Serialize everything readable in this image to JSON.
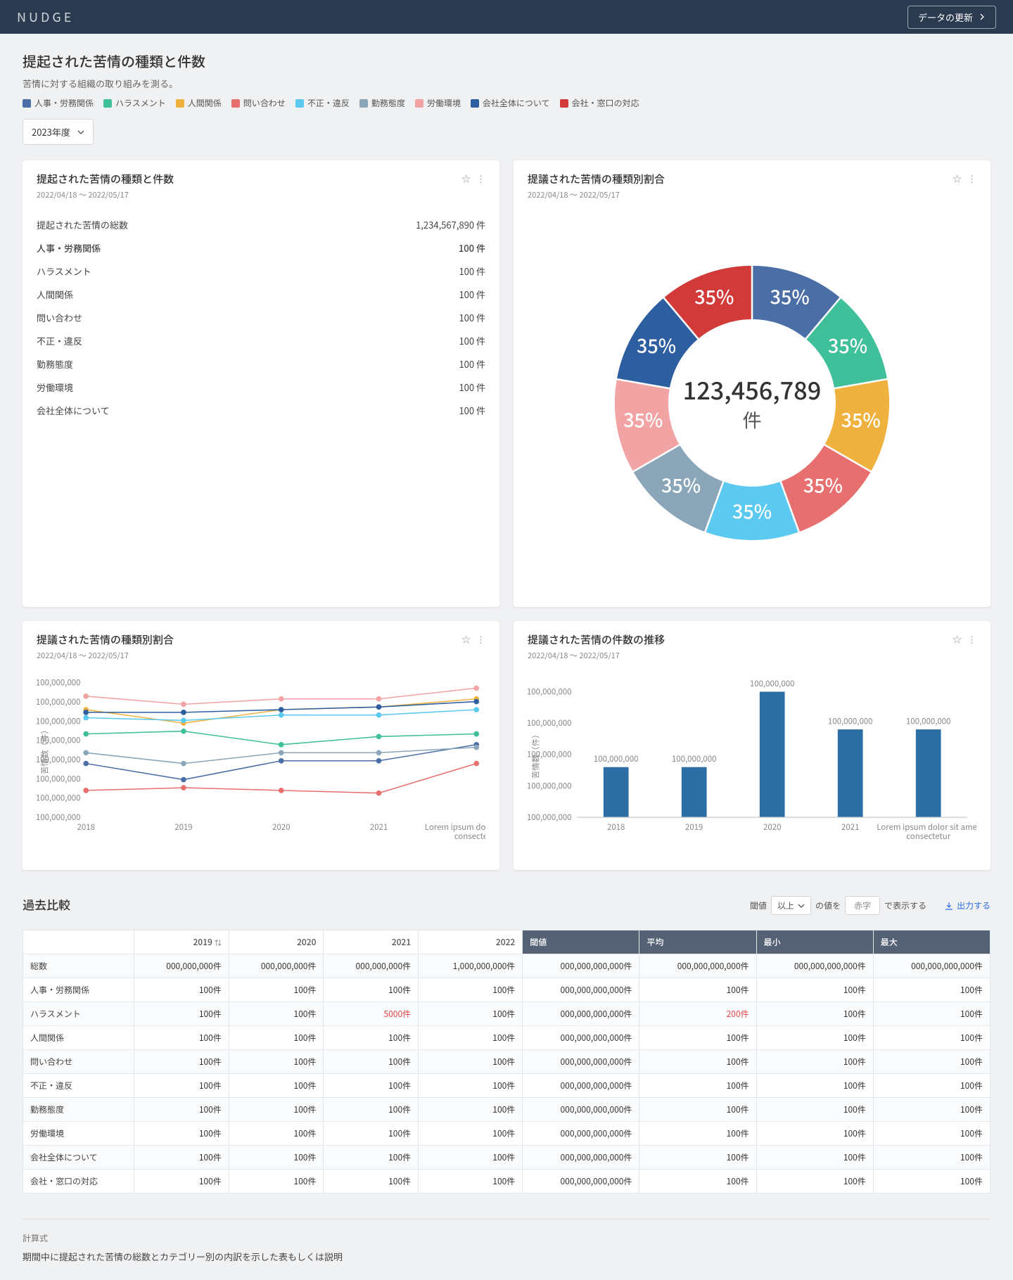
{
  "header": {
    "logo": "NUDGE",
    "update_btn": "データの更新"
  },
  "page": {
    "title": "提起された苦情の種類と件数",
    "subtitle": "苦情に対する組織の取り組みを測る。",
    "year_select": "2023年度"
  },
  "legend": [
    {
      "label": "人事・労務関係",
      "color": "#4a6ea5"
    },
    {
      "label": "ハラスメント",
      "color": "#3fbf9a"
    },
    {
      "label": "人間関係",
      "color": "#f0b23e"
    },
    {
      "label": "問い合わせ",
      "color": "#e76f6f"
    },
    {
      "label": "不正・違反",
      "color": "#5ccaf0"
    },
    {
      "label": "勤務態度",
      "color": "#8aa6b8"
    },
    {
      "label": "労働環境",
      "color": "#f2a3a3"
    },
    {
      "label": "会社全体について",
      "color": "#2d5ea0"
    },
    {
      "label": "会社・窓口の対応",
      "color": "#d23a3a"
    }
  ],
  "cards": {
    "summary": {
      "title": "提起された苦情の種類と件数",
      "date": "2022/04/18 〜 2022/05/17",
      "total_label": "提起された苦情の総数",
      "total_value": "1,234,567,890 件",
      "rows": [
        {
          "label": "人事・労務関係",
          "value": "100 件"
        },
        {
          "label": "ハラスメント",
          "value": "100 件"
        },
        {
          "label": "人間関係",
          "value": "100 件"
        },
        {
          "label": "問い合わせ",
          "value": "100 件"
        },
        {
          "label": "不正・違反",
          "value": "100 件"
        },
        {
          "label": "勤務態度",
          "value": "100 件"
        },
        {
          "label": "労働環境",
          "value": "100 件"
        },
        {
          "label": "会社全体について",
          "value": "100 件"
        }
      ]
    },
    "donut": {
      "title": "提議された苦情の種類別割合",
      "date": "2022/04/18 〜 2022/05/17",
      "center_value": "123,456,789",
      "center_unit": "件"
    },
    "line": {
      "title": "提議された苦情の種類別割合",
      "date": "2022/04/18 〜 2022/05/17",
      "ylabel": "苦情数（件）"
    },
    "bar": {
      "title": "提議された苦情の件数の推移",
      "date": "2022/04/18 〜 2022/05/17",
      "ylabel": "苦情数（件）"
    }
  },
  "compare": {
    "title": "過去比較",
    "threshold_label": "閾値",
    "cond_select": "以上",
    "value_label": "の値を",
    "redtext_label": "赤字",
    "display_label": "で表示する",
    "export": "出力する",
    "headers": {
      "y2019": "2019",
      "y2020": "2020",
      "y2021": "2021",
      "y2022": "2022",
      "threshold": "閾値",
      "avg": "平均",
      "min": "最小",
      "max": "最大"
    },
    "rows": [
      {
        "label": "総数",
        "y2019": "000,000,000件",
        "y2020": "000,000,000件",
        "y2021": "000,000,000件",
        "y2022": "1,000,000,000件",
        "threshold": "000,000,000,000件",
        "avg": "000,000,000,000件",
        "min": "000,000,000,000件",
        "max": "000,000,000,000件",
        "red": {}
      },
      {
        "label": "人事・労務関係",
        "y2019": "100件",
        "y2020": "100件",
        "y2021": "100件",
        "y2022": "100件",
        "threshold": "000,000,000,000件",
        "avg": "100件",
        "min": "100件",
        "max": "100件",
        "red": {}
      },
      {
        "label": "ハラスメント",
        "y2019": "100件",
        "y2020": "100件",
        "y2021": "5000件",
        "y2022": "100件",
        "threshold": "000,000,000,000件",
        "avg": "200件",
        "min": "100件",
        "max": "100件",
        "red": {
          "y2021": true,
          "avg": true
        }
      },
      {
        "label": "人間関係",
        "y2019": "100件",
        "y2020": "100件",
        "y2021": "100件",
        "y2022": "100件",
        "threshold": "000,000,000,000件",
        "avg": "100件",
        "min": "100件",
        "max": "100件",
        "red": {}
      },
      {
        "label": "問い合わせ",
        "y2019": "100件",
        "y2020": "100件",
        "y2021": "100件",
        "y2022": "100件",
        "threshold": "000,000,000,000件",
        "avg": "100件",
        "min": "100件",
        "max": "100件",
        "red": {}
      },
      {
        "label": "不正・違反",
        "y2019": "100件",
        "y2020": "100件",
        "y2021": "100件",
        "y2022": "100件",
        "threshold": "000,000,000,000件",
        "avg": "100件",
        "min": "100件",
        "max": "100件",
        "red": {}
      },
      {
        "label": "勤務態度",
        "y2019": "100件",
        "y2020": "100件",
        "y2021": "100件",
        "y2022": "100件",
        "threshold": "000,000,000,000件",
        "avg": "100件",
        "min": "100件",
        "max": "100件",
        "red": {}
      },
      {
        "label": "労働環境",
        "y2019": "100件",
        "y2020": "100件",
        "y2021": "100件",
        "y2022": "100件",
        "threshold": "000,000,000,000件",
        "avg": "100件",
        "min": "100件",
        "max": "100件",
        "red": {}
      },
      {
        "label": "会社全体について",
        "y2019": "100件",
        "y2020": "100件",
        "y2021": "100件",
        "y2022": "100件",
        "threshold": "000,000,000,000件",
        "avg": "100件",
        "min": "100件",
        "max": "100件",
        "red": {}
      },
      {
        "label": "会社・窓口の対応",
        "y2019": "100件",
        "y2020": "100件",
        "y2021": "100件",
        "y2022": "100件",
        "threshold": "000,000,000,000件",
        "avg": "100件",
        "min": "100件",
        "max": "100件",
        "red": {}
      }
    ]
  },
  "calc": {
    "label": "計算式",
    "desc": "期間中に提起された苦情の総数とカテゴリー別の内訳を示した表もしくは説明"
  },
  "chart_data": [
    {
      "type": "pie",
      "title": "提議された苦情の種類別割合",
      "center_label": "123,456,789 件",
      "slices": [
        {
          "name": "人事・労務関係",
          "pct": 35,
          "color": "#4a6ea5"
        },
        {
          "name": "ハラスメント",
          "pct": 35,
          "color": "#3fbf9a"
        },
        {
          "name": "人間関係",
          "pct": 35,
          "color": "#f0b23e"
        },
        {
          "name": "問い合わせ",
          "pct": 35,
          "color": "#e76f6f"
        },
        {
          "name": "不正・違反",
          "pct": 35,
          "color": "#5ccaf0"
        },
        {
          "name": "勤務態度",
          "pct": 35,
          "color": "#8aa6b8"
        },
        {
          "name": "労働環境",
          "pct": 35,
          "color": "#f2a3a3"
        },
        {
          "name": "会社全体について",
          "pct": 35,
          "color": "#2d5ea0"
        },
        {
          "name": "会社・窓口の対応",
          "pct": 35,
          "color": "#d23a3a"
        }
      ]
    },
    {
      "type": "line",
      "title": "提議された苦情の種類別割合",
      "xlabel": "",
      "ylabel": "苦情数（件）",
      "categories": [
        "2018",
        "2019",
        "2020",
        "2021",
        "Lorem ipsum dolor sit amet, consectetur"
      ],
      "y_ticks": [
        "100,000,000",
        "100,000,000",
        "100,000,000",
        "100,000,000",
        "100,000,000",
        "100,000,000",
        "100,000,000",
        "100,000,000"
      ],
      "series": [
        {
          "name": "人事・労務関係",
          "color": "#4a6ea5",
          "values": [
            40,
            28,
            42,
            42,
            54
          ]
        },
        {
          "name": "ハラスメント",
          "color": "#3fbf9a",
          "values": [
            62,
            64,
            54,
            60,
            62
          ]
        },
        {
          "name": "人間関係",
          "color": "#f0b23e",
          "values": [
            80,
            70,
            80,
            82,
            88
          ]
        },
        {
          "name": "問い合わせ",
          "color": "#e76f6f",
          "values": [
            20,
            22,
            20,
            18,
            40
          ]
        },
        {
          "name": "不正・違反",
          "color": "#5ccaf0",
          "values": [
            74,
            72,
            76,
            76,
            80
          ]
        },
        {
          "name": "勤務態度",
          "color": "#8aa6b8",
          "values": [
            48,
            40,
            48,
            48,
            52
          ]
        },
        {
          "name": "労働環境",
          "color": "#f2a3a3",
          "values": [
            90,
            84,
            88,
            88,
            96
          ]
        },
        {
          "name": "会社全体について",
          "color": "#2d5ea0",
          "values": [
            78,
            78,
            80,
            82,
            86
          ]
        }
      ]
    },
    {
      "type": "bar",
      "title": "提議された苦情の件数の推移",
      "xlabel": "",
      "ylabel": "苦情数（件）",
      "y_ticks": [
        "100,000,000",
        "100,000,000",
        "100,000,000",
        "100,000,000",
        "100,000,000"
      ],
      "categories": [
        "2018",
        "2019",
        "2020",
        "2021",
        "Lorem ipsum dolor sit amet, consectetur"
      ],
      "values_label": [
        "100,000,000",
        "100,000,000",
        "100,000,000",
        "100,000,000",
        "100,000,000"
      ],
      "values": [
        40,
        40,
        100,
        70,
        70
      ]
    }
  ]
}
